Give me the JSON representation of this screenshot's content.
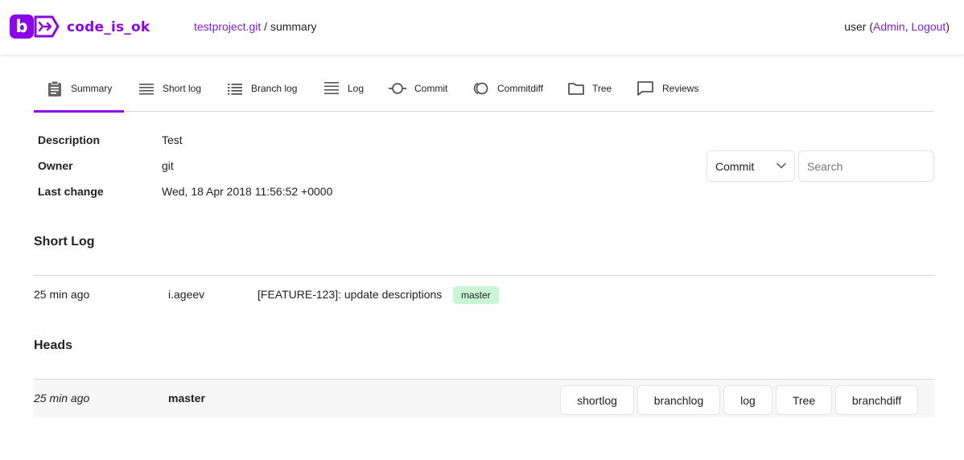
{
  "header": {
    "logo_letter": "b",
    "logo_text": "code_is_ok",
    "project_link": "testproject.git",
    "separator": " / ",
    "page": "summary",
    "user": "user",
    "admin_label": "Admin",
    "logout_label": "Logout",
    "brand_color": "#8a06e6"
  },
  "tabs": [
    {
      "label": "Summary",
      "icon": "clipboard-icon",
      "active": true
    },
    {
      "label": "Short log",
      "icon": "list-lines-icon"
    },
    {
      "label": "Branch log",
      "icon": "bullet-list-icon"
    },
    {
      "label": "Log",
      "icon": "log-lines-icon"
    },
    {
      "label": "Commit",
      "icon": "commit-icon"
    },
    {
      "label": "Commitdiff",
      "icon": "commitdiff-icon"
    },
    {
      "label": "Tree",
      "icon": "folder-icon"
    },
    {
      "label": "Reviews",
      "icon": "speech-bubble-icon"
    }
  ],
  "meta": {
    "description_label": "Description",
    "description_value": "Test",
    "owner_label": "Owner",
    "owner_value": "git",
    "last_change_label": "Last change",
    "last_change_value": "Wed, 18 Apr 2018 11:56:52 +0000"
  },
  "search": {
    "type_selected": "Commit",
    "placeholder": "Search"
  },
  "short_log": {
    "title": "Short Log",
    "rows": [
      {
        "age": "25 min ago",
        "author": "i.ageev",
        "message": "[FEATURE-123]: update descriptions",
        "tag": "master",
        "tag_color": "#c9f7d6"
      }
    ]
  },
  "heads": {
    "title": "Heads",
    "rows": [
      {
        "age": "25 min ago",
        "name": "master",
        "actions": [
          "shortlog",
          "branchlog",
          "log",
          "Tree",
          "branchdiff"
        ]
      }
    ]
  }
}
